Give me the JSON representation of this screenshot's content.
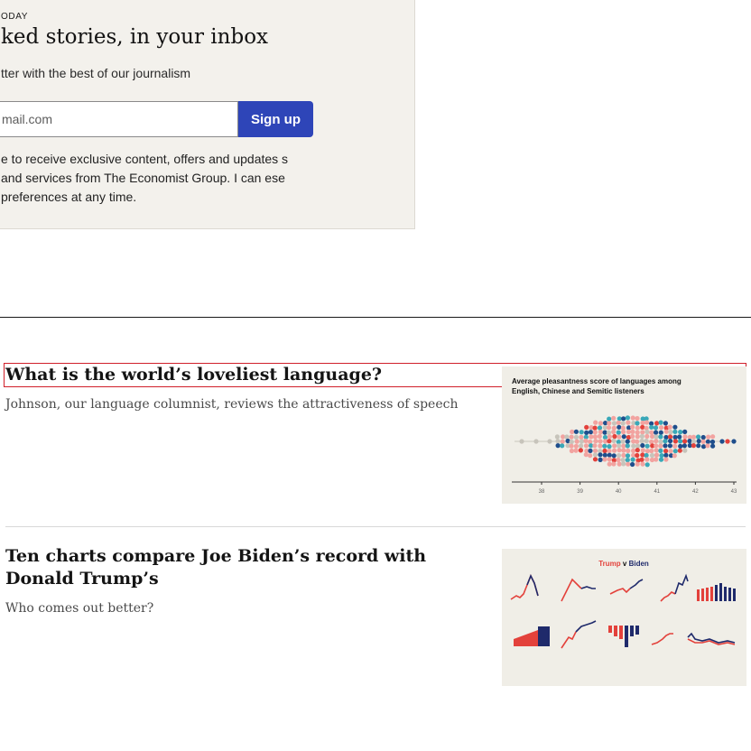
{
  "newsletter": {
    "kicker": "ODAY",
    "title": "ked stories, in your inbox",
    "subtitle": "tter with the best of our journalism",
    "email_placeholder": "mail.com",
    "signup_label": "Sign up",
    "consent_text": "e to receive exclusive content, offers and updates s and services from The Economist Group. I can ese preferences at any time.",
    "accent_color": "#2e45b8"
  },
  "stories": [
    {
      "title": "What is the world’s loveliest language?",
      "description": "Johnson, our language columnist, reviews the attractiveness of speech",
      "thumbnail": {
        "title": "Average pleasantness score of languages among English, Chinese and Semitic listeners",
        "axis_ticks": [
          "38",
          "39",
          "40",
          "41",
          "42",
          "43"
        ]
      }
    },
    {
      "title": "Ten charts compare Joe Biden’s record with Donald Trump’s",
      "description": "Who comes out better?",
      "thumbnail": {
        "title_left": "Trump",
        "title_mid": " v ",
        "title_right": "Biden",
        "trump_color": "#e3413b",
        "biden_color": "#1f2a6b"
      }
    }
  ]
}
